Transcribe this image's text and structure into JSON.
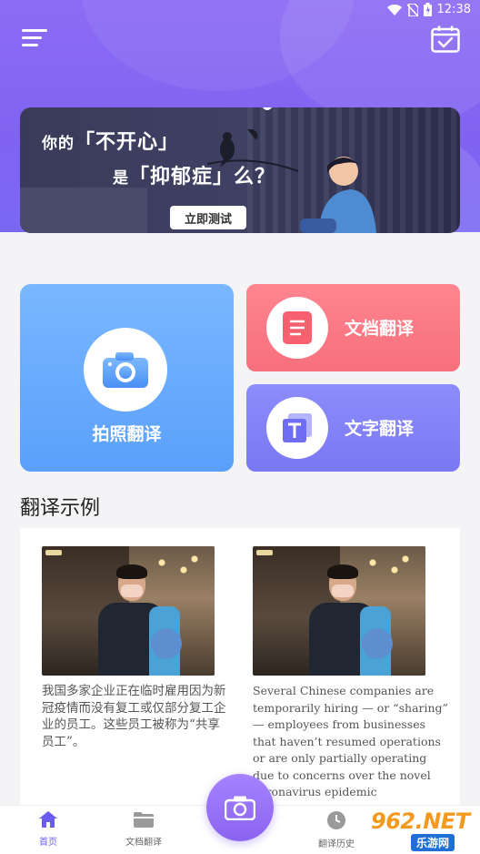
{
  "status_bar": {
    "time": "12:38"
  },
  "banner": {
    "line1_small": "你的",
    "line1_big": "「不开心」",
    "line2_small": "是",
    "line2_big": "「抑郁症」",
    "line2_tail": "么？",
    "button": "立即测试"
  },
  "cards": {
    "photo_label": "拍照翻译",
    "doc_label": "文档翻译",
    "text_label": "文字翻译"
  },
  "section_title": "翻译示例",
  "examples": {
    "chinese": "我国多家企业正在临时雇用因为新冠疫情而没有复工或仅部分复工企业的员工。这些员工被称为“共享员工”。",
    "english": "Several Chinese companies are temporarily hiring — or “sharing” — employees from businesses that haven’t resumed operations or are only partially operating due to concerns over the novel coronavirus epidemic"
  },
  "bottom_nav": {
    "home": "首页",
    "doc": "文档翻译",
    "history": "翻译历史"
  },
  "watermark": {
    "main": "962.NET",
    "sub": "乐游网"
  },
  "colors": {
    "header": "#8d6cf5",
    "photo_card": "#6aa9fd",
    "doc_card": "#f87480",
    "text_card": "#8280f6",
    "nav_active": "#6a5cf0"
  }
}
